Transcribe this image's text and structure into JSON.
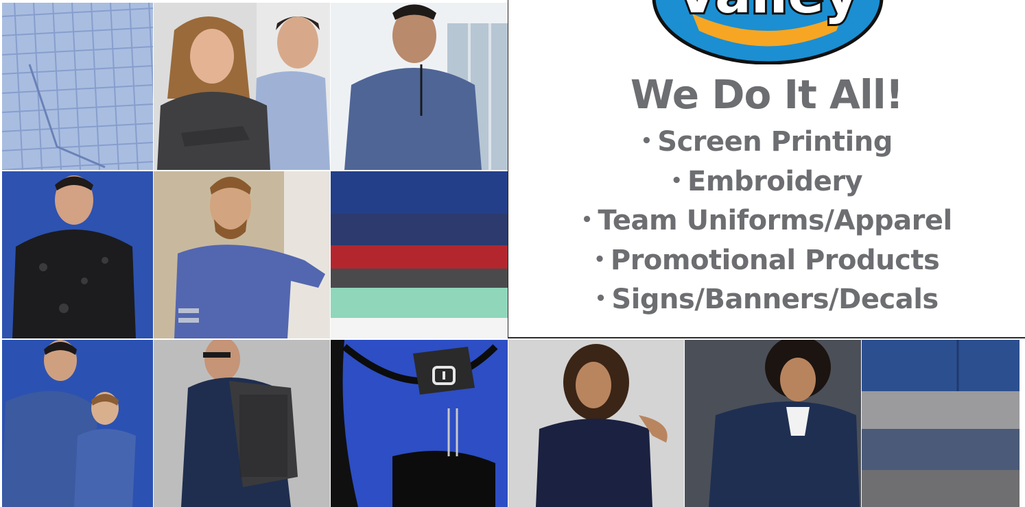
{
  "logo": {
    "text": "Valley"
  },
  "headline": "We Do It All!",
  "services": [
    "Screen Printing",
    "Embroidery",
    "Team Uniforms/Apparel",
    "Promotional Products",
    "Signs/Banners/Decals"
  ],
  "bullet": "•",
  "colors": {
    "text_gray": "#6d6e71",
    "logo_blue": "#1b8fd2",
    "logo_orange": "#f6a623",
    "backdrop_blue": "#2f58b8"
  }
}
